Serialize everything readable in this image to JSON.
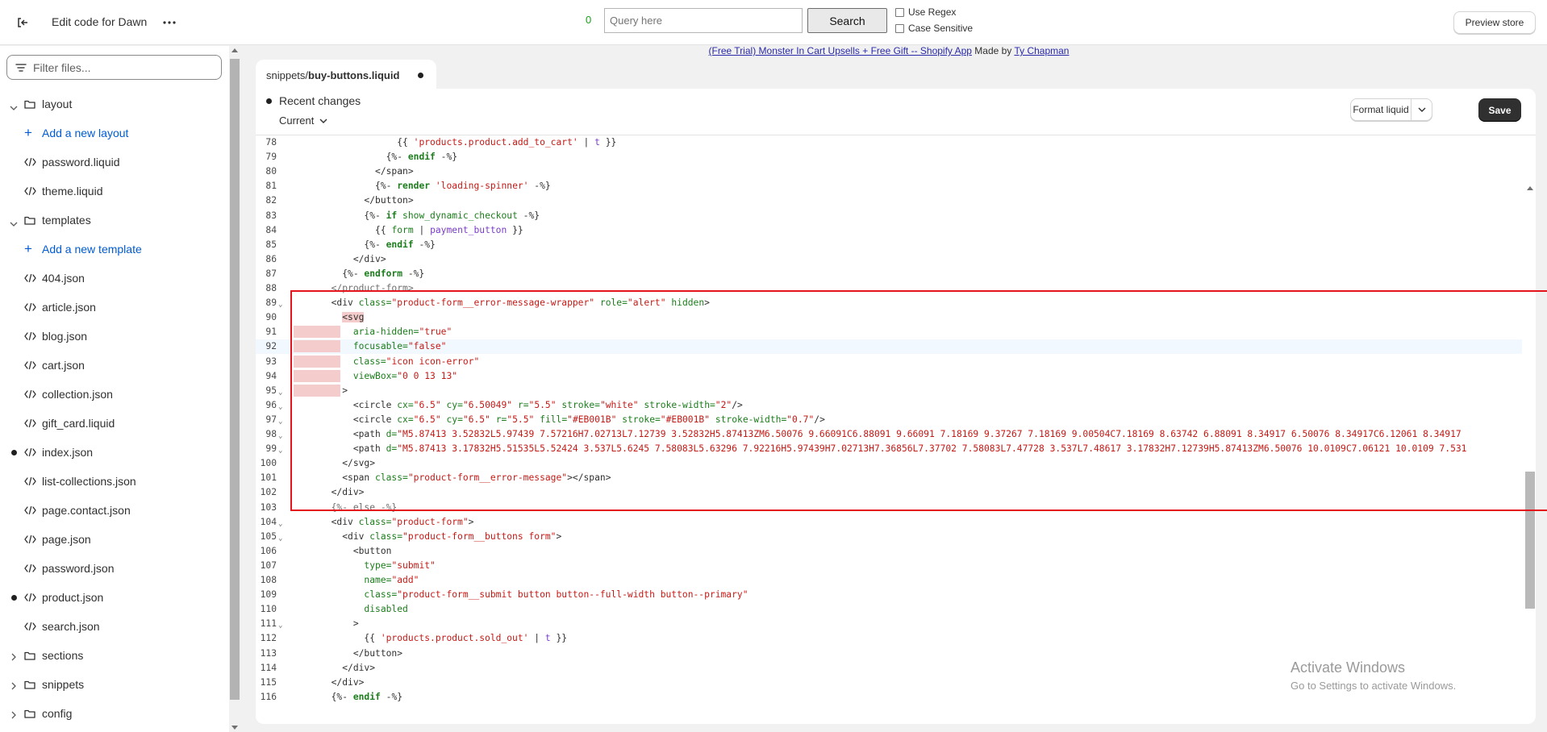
{
  "topbar": {
    "title": "Edit code for Dawn",
    "match_count": "0",
    "query_placeholder": "Query here",
    "search_label": "Search",
    "use_regex_label": "Use Regex",
    "case_sensitive_label": "Case Sensitive",
    "preview_label": "Preview store"
  },
  "banner": {
    "link_text": "(Free Trial) Monster In Cart Upsells + Free Gift -- Shopify App",
    "made_by": " Made by ",
    "author": "Ty Chapman"
  },
  "sidebar": {
    "filter_placeholder": "Filter files...",
    "items": [
      {
        "label": "layout",
        "kind": "folder",
        "expanded": true
      },
      {
        "label": "Add a new layout",
        "kind": "add"
      },
      {
        "label": "password.liquid",
        "kind": "file"
      },
      {
        "label": "theme.liquid",
        "kind": "file"
      },
      {
        "label": "templates",
        "kind": "folder",
        "expanded": true
      },
      {
        "label": "Add a new template",
        "kind": "add"
      },
      {
        "label": "404.json",
        "kind": "file"
      },
      {
        "label": "article.json",
        "kind": "file"
      },
      {
        "label": "blog.json",
        "kind": "file"
      },
      {
        "label": "cart.json",
        "kind": "file"
      },
      {
        "label": "collection.json",
        "kind": "file"
      },
      {
        "label": "gift_card.liquid",
        "kind": "file"
      },
      {
        "label": "index.json",
        "kind": "file",
        "modified": true
      },
      {
        "label": "list-collections.json",
        "kind": "file"
      },
      {
        "label": "page.contact.json",
        "kind": "file"
      },
      {
        "label": "page.json",
        "kind": "file"
      },
      {
        "label": "password.json",
        "kind": "file"
      },
      {
        "label": "product.json",
        "kind": "file",
        "modified": true
      },
      {
        "label": "search.json",
        "kind": "file"
      },
      {
        "label": "sections",
        "kind": "folder",
        "expanded": false
      },
      {
        "label": "snippets",
        "kind": "folder",
        "expanded": false
      },
      {
        "label": "config",
        "kind": "folder",
        "expanded": false
      }
    ]
  },
  "tab": {
    "folder": "snippets/",
    "file": "buy-buttons.liquid"
  },
  "editor": {
    "recent_changes": "Recent changes",
    "current": "Current",
    "format_label": "Format liquid",
    "save_label": "Save"
  },
  "code_lines": [
    {
      "n": "78",
      "fold": false,
      "html": "            {{ <span class=\"s\">'products.product.add_to_cart'</span> | <span class=\"f\">t</span> }}"
    },
    {
      "n": "79",
      "fold": false,
      "html": "          <span class=\"t\">{%-</span> <span class=\"k\">endif</span> -%}"
    },
    {
      "n": "80",
      "fold": false,
      "html": "        &lt;/span&gt;"
    },
    {
      "n": "81",
      "fold": false,
      "html": "        {%- <span class=\"k\">render</span> <span class=\"s\">'loading-spinner'</span> -%}"
    },
    {
      "n": "82",
      "fold": false,
      "html": "      &lt;/button&gt;"
    },
    {
      "n": "83",
      "fold": false,
      "html": "      {%- <span class=\"k\">if</span> <span class=\"a\">show_dynamic_checkout</span> -%}"
    },
    {
      "n": "84",
      "fold": false,
      "html": "        {{ <span class=\"a\">form</span> | <span class=\"f\">payment_button</span> }}"
    },
    {
      "n": "85",
      "fold": false,
      "html": "      {%- <span class=\"k\">endif</span> -%}"
    },
    {
      "n": "86",
      "fold": false,
      "html": "    &lt;/div&gt;"
    },
    {
      "n": "87",
      "fold": false,
      "html": "  {%- <span class=\"k\">endform</span> -%}"
    },
    {
      "n": "88",
      "fold": false,
      "html": "<span class=\"dim\">&lt;/product-form&gt;</span>"
    },
    {
      "n": "89",
      "fold": true,
      "html": "&lt;div <span class=\"a\">class=</span><span class=\"s\">\"product-form__error-message-wrapper\"</span> <span class=\"a\">role=</span><span class=\"s\">\"alert\"</span> <span class=\"a\">hidden</span>&gt;"
    },
    {
      "n": "90",
      "fold": false,
      "html": "  <span class=\"hl\">&lt;svg</span>"
    },
    {
      "n": "91",
      "fold": false,
      "html": "    <span class=\"a\">aria-hidden=</span><span class=\"s\">\"true\"</span>"
    },
    {
      "n": "92",
      "fold": false,
      "html": "    <span class=\"a\">focusable=</span><span class=\"s\">\"false\"</span>"
    },
    {
      "n": "93",
      "fold": false,
      "html": "    <span class=\"a\">class=</span><span class=\"s\">\"icon icon-error\"</span>"
    },
    {
      "n": "94",
      "fold": false,
      "html": "    <span class=\"a\">viewBox=</span><span class=\"s\">\"0 0 13 13\"</span>"
    },
    {
      "n": "95",
      "fold": true,
      "html": "  &gt;"
    },
    {
      "n": "96",
      "fold": true,
      "html": "    &lt;circle <span class=\"a\">cx=</span><span class=\"s\">\"6.5\"</span> <span class=\"a\">cy=</span><span class=\"s\">\"6.50049\"</span> <span class=\"a\">r=</span><span class=\"s\">\"5.5\"</span> <span class=\"a\">stroke=</span><span class=\"s\">\"white\"</span> <span class=\"a\">stroke-width=</span><span class=\"s\">\"2\"</span>/&gt;"
    },
    {
      "n": "97",
      "fold": true,
      "html": "    &lt;circle <span class=\"a\">cx=</span><span class=\"s\">\"6.5\"</span> <span class=\"a\">cy=</span><span class=\"s\">\"6.5\"</span> <span class=\"a\">r=</span><span class=\"s\">\"5.5\"</span> <span class=\"a\">fill=</span><span class=\"s\">\"#EB001B\"</span> <span class=\"a\">stroke=</span><span class=\"s\">\"#EB001B\"</span> <span class=\"a\">stroke-width=</span><span class=\"s\">\"0.7\"</span>/&gt;"
    },
    {
      "n": "98",
      "fold": true,
      "html": "    &lt;path <span class=\"a\">d=</span><span class=\"s\">\"M5.87413 3.52832L5.97439 7.57216H7.02713L7.12739 3.52832H5.87413ZM6.50076 9.66091C6.88091 9.66091 7.18169 9.37267 7.18169 9.00504C7.18169 8.63742 6.88091 8.34917 6.50076 8.34917C6.12061 8.34917</span>"
    },
    {
      "n": "99",
      "fold": true,
      "html": "    &lt;path <span class=\"a\">d=</span><span class=\"s\">\"M5.87413 3.17832H5.51535L5.52424 3.537L5.6245 7.58083L5.63296 7.92216H5.97439H7.02713H7.36856L7.37702 7.58083L7.47728 3.537L7.48617 3.17832H7.12739H5.87413ZM6.50076 10.0109C7.06121 10.0109 7.531</span>"
    },
    {
      "n": "100",
      "fold": false,
      "html": "  &lt;/svg&gt;"
    },
    {
      "n": "101",
      "fold": false,
      "html": "  &lt;span <span class=\"a\">class=</span><span class=\"s\">\"product-form__error-message\"</span>&gt;&lt;/span&gt;"
    },
    {
      "n": "102",
      "fold": false,
      "html": "&lt;/div&gt;"
    },
    {
      "n": "103",
      "fold": false,
      "html": "<span class=\"dim\">{%- else -%}</span>"
    },
    {
      "n": "104",
      "fold": true,
      "html": "&lt;div <span class=\"a\">class=</span><span class=\"s\">\"product-form\"</span>&gt;"
    },
    {
      "n": "105",
      "fold": true,
      "html": "  &lt;div <span class=\"a\">class=</span><span class=\"s\">\"product-form__buttons form\"</span>&gt;"
    },
    {
      "n": "106",
      "fold": false,
      "html": "    &lt;button"
    },
    {
      "n": "107",
      "fold": false,
      "html": "      <span class=\"a\">type=</span><span class=\"s\">\"submit\"</span>"
    },
    {
      "n": "108",
      "fold": false,
      "html": "      <span class=\"a\">name=</span><span class=\"s\">\"add\"</span>"
    },
    {
      "n": "109",
      "fold": false,
      "html": "      <span class=\"a\">class=</span><span class=\"s\">\"product-form__submit button button--full-width button--primary\"</span>"
    },
    {
      "n": "110",
      "fold": false,
      "html": "      <span class=\"a\">disabled</span>"
    },
    {
      "n": "111",
      "fold": true,
      "html": "    &gt;"
    },
    {
      "n": "112",
      "fold": false,
      "html": "      {{ <span class=\"s\">'products.product.sold_out'</span> | <span class=\"f\">t</span> }}"
    },
    {
      "n": "113",
      "fold": false,
      "html": "    &lt;/button&gt;"
    },
    {
      "n": "114",
      "fold": false,
      "html": "  &lt;/div&gt;"
    },
    {
      "n": "115",
      "fold": false,
      "html": "&lt;/div&gt;"
    },
    {
      "n": "116",
      "fold": false,
      "html": "{%- <span class=\"k\">endif</span> -%}"
    }
  ],
  "watermark": {
    "line1": "Activate Windows",
    "line2": "Go to Settings to activate Windows."
  },
  "colors": {
    "accent_link": "#005bd3",
    "highlight_box": "#e3141b",
    "removed_line": "#f4cccc"
  }
}
